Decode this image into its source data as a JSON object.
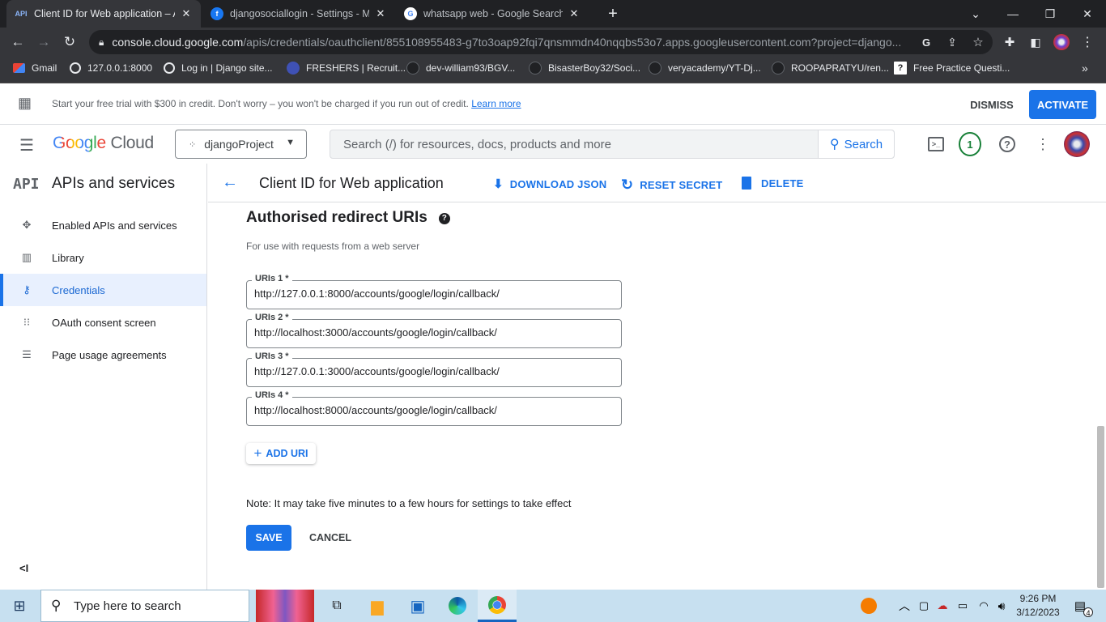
{
  "browser": {
    "tabs": [
      {
        "title": "Client ID for Web application – A",
        "favicon": "API",
        "active": true
      },
      {
        "title": "djangosociallogin - Settings - Me",
        "favicon": "facebook-icon",
        "active": false
      },
      {
        "title": "whatsapp web - Google Search",
        "favicon": "google-icon",
        "active": false
      }
    ],
    "url_host": "console.cloud.google.com",
    "url_path": "/apis/credentials/oauthclient/855108955483-g7to3oap92fqi7qnsmmdn40nqqbs53o7.apps.googleusercontent.com?project=django...",
    "bookmarks": [
      "Gmail",
      "127.0.0.1:8000",
      "Log in | Django site...",
      "FRESHERS | Recruit...",
      "dev-william93/BGV...",
      "BisasterBoy32/Soci...",
      "veryacademy/YT-Dj...",
      "ROOPAPRATYU/ren...",
      "Free Practice Questi..."
    ]
  },
  "banner": {
    "message": "Start your free trial with $300 in credit. Don't worry – you won't be charged if you run out of credit.",
    "link": "Learn more",
    "dismiss": "DISMISS",
    "activate": "ACTIVATE"
  },
  "header": {
    "logo_google": "Google",
    "logo_cloud": "Cloud",
    "project": "djangoProject",
    "search_placeholder": "Search (/) for resources, docs, products and more",
    "search_button": "Search",
    "notifications": "1"
  },
  "sidebar": {
    "badge": "API",
    "title": "APIs and services",
    "items": [
      {
        "label": "Enabled APIs and services",
        "icon": "diamond-icon"
      },
      {
        "label": "Library",
        "icon": "library-icon"
      },
      {
        "label": "Credentials",
        "icon": "key-icon"
      },
      {
        "label": "OAuth consent screen",
        "icon": "consent-icon"
      },
      {
        "label": "Page usage agreements",
        "icon": "settings-list-icon"
      }
    ],
    "selected": "Credentials",
    "collapse": "<I"
  },
  "page": {
    "title": "Client ID for Web application",
    "download": "DOWNLOAD JSON",
    "reset": "RESET SECRET",
    "delete": "DELETE",
    "section_title": "Authorised redirect URIs",
    "section_sub": "For use with requests from a web server",
    "uris": [
      {
        "label": "URIs 1 *",
        "value": "http://127.0.0.1:8000/accounts/google/login/callback/"
      },
      {
        "label": "URIs 2 *",
        "value": "http://localhost:3000/accounts/google/login/callback/"
      },
      {
        "label": "URIs 3 *",
        "value": "http://127.0.0.1:3000/accounts/google/login/callback/"
      },
      {
        "label": "URIs 4 *",
        "value": "http://localhost:8000/accounts/google/login/callback/"
      }
    ],
    "add_uri": "ADD URI",
    "note": "Note: It may take five minutes to a few hours for settings to take effect",
    "save": "SAVE",
    "cancel": "CANCEL"
  },
  "taskbar": {
    "search_placeholder": "Type here to search",
    "time": "9:26 PM",
    "date": "3/12/2023",
    "notification_count": "4"
  },
  "colors": {
    "accent": "#1a73e8",
    "chrome_dark": "#202124",
    "chrome_toolbar": "#35363a",
    "taskbar": "#c7e0f0"
  }
}
